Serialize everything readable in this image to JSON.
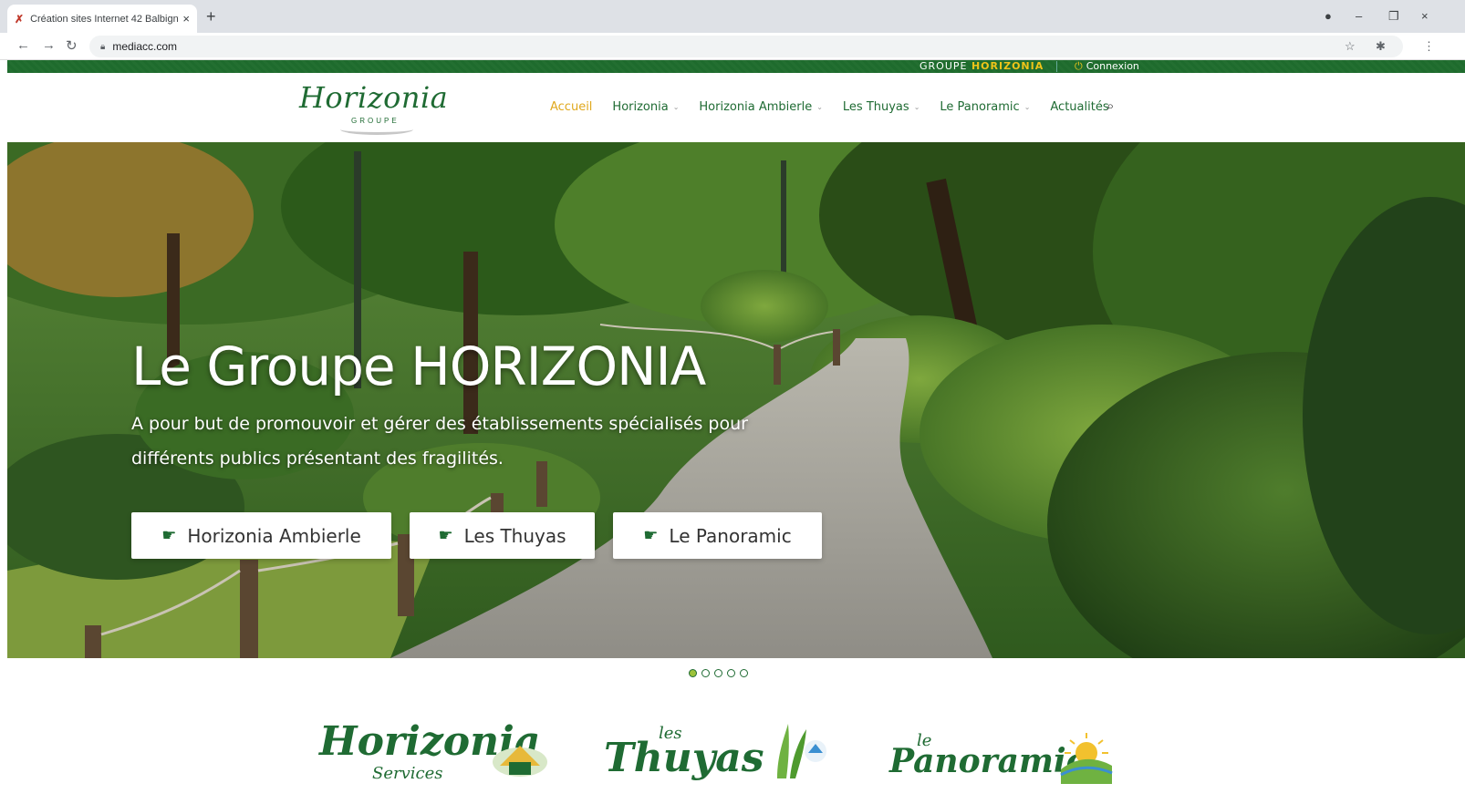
{
  "browser": {
    "tab_title": "Création sites Internet 42 Balbigny",
    "tab_close": "×",
    "new_tab": "+",
    "url": "mediacc.com",
    "win_minimize": "–",
    "win_restore": "❐",
    "win_close": "×"
  },
  "topbar": {
    "groupe_prefix": "GROUPE ",
    "groupe_highlight": "HORIZONIA",
    "login_label": "Connexion"
  },
  "logo": {
    "word": "Horizonia",
    "sub": "GROUPE"
  },
  "nav": {
    "items": [
      {
        "label": "Accueil",
        "active": true,
        "has_caret": false
      },
      {
        "label": "Horizonia",
        "active": false,
        "has_caret": true
      },
      {
        "label": "Horizonia Ambierle",
        "active": false,
        "has_caret": true
      },
      {
        "label": "Les Thuyas",
        "active": false,
        "has_caret": true
      },
      {
        "label": "Le Panoramic",
        "active": false,
        "has_caret": true
      },
      {
        "label": "Actualités",
        "active": false,
        "has_caret": false
      }
    ],
    "caret": "⌄"
  },
  "hero": {
    "title": "Le Groupe HORIZONIA",
    "subtitle": "A pour but de promouvoir et gérer des établissements spécialisés pour différents publics présentant des fragilités.",
    "buttons": [
      {
        "label": "Horizonia Ambierle"
      },
      {
        "label": "Les Thuyas"
      },
      {
        "label": "Le Panoramic"
      }
    ]
  },
  "slider": {
    "dot_count": 5,
    "active_index": 0
  },
  "partners": {
    "horizonia_big": "Horizonia",
    "horizonia_small": "Services",
    "thuyas_small": "les",
    "thuyas_big": "Thuyas",
    "panoramic_small": "le",
    "panoramic_big": "Panoramic"
  },
  "colors": {
    "brand_green": "#1f6b33",
    "accent_yellow": "#e0a81d"
  }
}
